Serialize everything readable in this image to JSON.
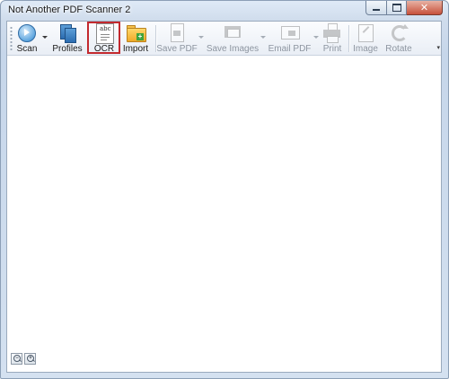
{
  "window": {
    "title": "Not Another PDF Scanner 2"
  },
  "toolbar": {
    "scan_label": "Scan",
    "profiles_label": "Profiles",
    "ocr_label": "OCR",
    "ocr_icon_text": "abc",
    "import_label": "Import",
    "save_pdf_label": "Save PDF",
    "save_images_label": "Save Images",
    "email_pdf_label": "Email PDF",
    "print_label": "Print",
    "image_label": "Image",
    "rotate_label": "Rotate"
  },
  "zoom": {
    "zoom_in_symbol": "+",
    "zoom_out_symbol": "−"
  },
  "colors": {
    "highlight": "#c3292e",
    "accent": "#2f76b8"
  }
}
